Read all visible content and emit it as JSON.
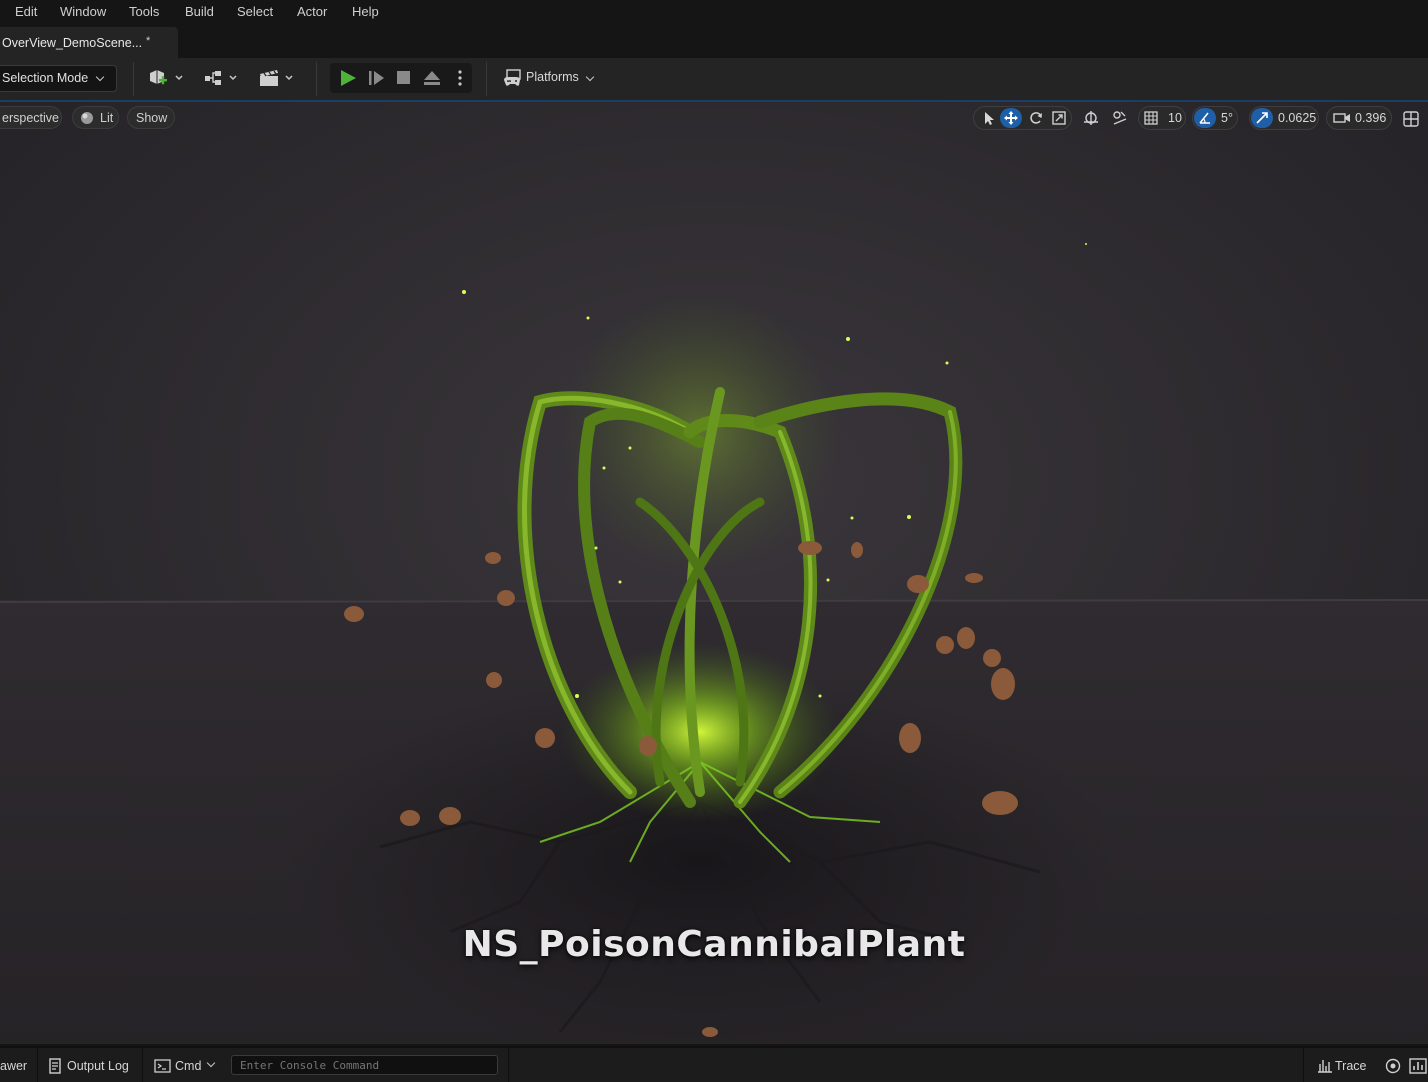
{
  "menu": [
    "Edit",
    "Window",
    "Tools",
    "Build",
    "Select",
    "Actor",
    "Help"
  ],
  "document_tab": {
    "label": "OverView_DemoScene...",
    "dirty_marker": "*"
  },
  "toolbar": {
    "selection_mode": "Selection Mode",
    "platforms": "Platforms",
    "accent_color": "#1f5fa8",
    "play_color": "#4fb33a"
  },
  "viewport": {
    "view_mode": "erspective",
    "lighting": "Lit",
    "show": "Show",
    "grid_snap": "10",
    "rotation_snap": "5°",
    "scale_snap": "0.0625",
    "camera_speed": "0.396",
    "scene_label": "NS_PoisonCannibalPlant"
  },
  "statusbar": {
    "drawer": "awer",
    "output_log": "Output Log",
    "cmd": "Cmd",
    "console_placeholder": "Enter Console Command",
    "trace": "Trace"
  }
}
